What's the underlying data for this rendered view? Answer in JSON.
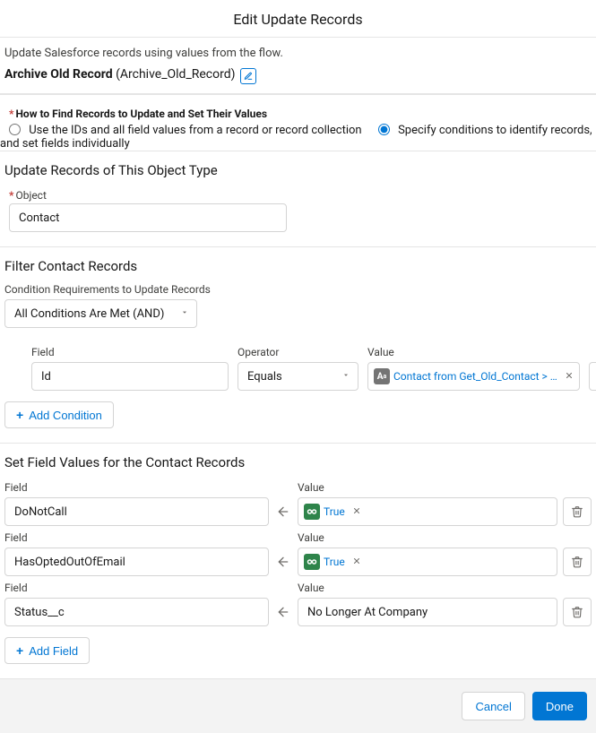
{
  "title": "Edit Update Records",
  "description": "Update Salesforce records using values from the flow.",
  "element": {
    "label": "Archive Old Record",
    "api": "(Archive_Old_Record)"
  },
  "howTo": {
    "heading": "How to Find Records to Update and Set Their Values",
    "opt1": "Use the IDs and all field values from a record or record collection",
    "opt2": "Specify conditions to identify records, and set fields individually",
    "selected": "opt2"
  },
  "objectSection": {
    "title": "Update Records of This Object Type",
    "label": "Object",
    "value": "Contact"
  },
  "filterSection": {
    "title": "Filter Contact Records",
    "reqLabel": "Condition Requirements to Update Records",
    "reqValue": "All Conditions Are Met (AND)",
    "cols": {
      "field": "Field",
      "operator": "Operator",
      "value": "Value"
    },
    "condition": {
      "field": "Id",
      "operator": "Equals",
      "value": "Contact from Get_Old_Contact > …"
    },
    "addCondition": "Add Condition"
  },
  "setSection": {
    "title": "Set Field Values for the Contact Records",
    "fieldLabel": "Field",
    "valueLabel": "Value",
    "rows": [
      {
        "field": "DoNotCall",
        "valueType": "bool",
        "value": "True"
      },
      {
        "field": "HasOptedOutOfEmail",
        "valueType": "bool",
        "value": "True"
      },
      {
        "field": "Status__c",
        "valueType": "text",
        "value": "No Longer At Company"
      }
    ],
    "addField": "Add Field"
  },
  "footer": {
    "cancel": "Cancel",
    "done": "Done"
  }
}
